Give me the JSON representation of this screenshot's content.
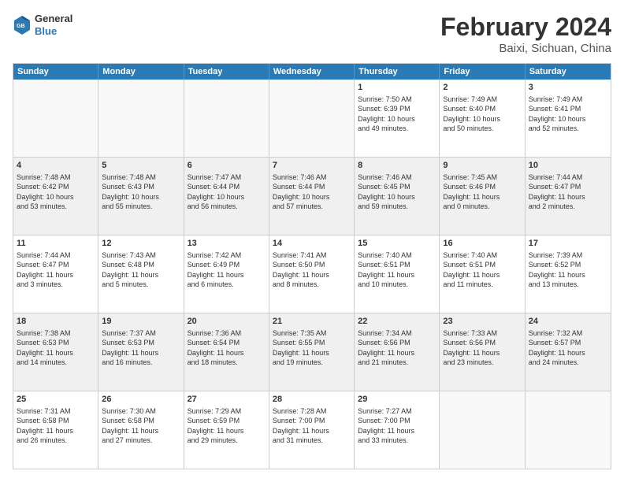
{
  "logo": {
    "general": "General",
    "blue": "Blue"
  },
  "title": "February 2024",
  "subtitle": "Baixi, Sichuan, China",
  "days": [
    "Sunday",
    "Monday",
    "Tuesday",
    "Wednesday",
    "Thursday",
    "Friday",
    "Saturday"
  ],
  "weeks": [
    [
      {
        "day": "",
        "lines": []
      },
      {
        "day": "",
        "lines": []
      },
      {
        "day": "",
        "lines": []
      },
      {
        "day": "",
        "lines": []
      },
      {
        "day": "1",
        "lines": [
          "Sunrise: 7:50 AM",
          "Sunset: 6:39 PM",
          "Daylight: 10 hours",
          "and 49 minutes."
        ]
      },
      {
        "day": "2",
        "lines": [
          "Sunrise: 7:49 AM",
          "Sunset: 6:40 PM",
          "Daylight: 10 hours",
          "and 50 minutes."
        ]
      },
      {
        "day": "3",
        "lines": [
          "Sunrise: 7:49 AM",
          "Sunset: 6:41 PM",
          "Daylight: 10 hours",
          "and 52 minutes."
        ]
      }
    ],
    [
      {
        "day": "4",
        "lines": [
          "Sunrise: 7:48 AM",
          "Sunset: 6:42 PM",
          "Daylight: 10 hours",
          "and 53 minutes."
        ]
      },
      {
        "day": "5",
        "lines": [
          "Sunrise: 7:48 AM",
          "Sunset: 6:43 PM",
          "Daylight: 10 hours",
          "and 55 minutes."
        ]
      },
      {
        "day": "6",
        "lines": [
          "Sunrise: 7:47 AM",
          "Sunset: 6:44 PM",
          "Daylight: 10 hours",
          "and 56 minutes."
        ]
      },
      {
        "day": "7",
        "lines": [
          "Sunrise: 7:46 AM",
          "Sunset: 6:44 PM",
          "Daylight: 10 hours",
          "and 57 minutes."
        ]
      },
      {
        "day": "8",
        "lines": [
          "Sunrise: 7:46 AM",
          "Sunset: 6:45 PM",
          "Daylight: 10 hours",
          "and 59 minutes."
        ]
      },
      {
        "day": "9",
        "lines": [
          "Sunrise: 7:45 AM",
          "Sunset: 6:46 PM",
          "Daylight: 11 hours",
          "and 0 minutes."
        ]
      },
      {
        "day": "10",
        "lines": [
          "Sunrise: 7:44 AM",
          "Sunset: 6:47 PM",
          "Daylight: 11 hours",
          "and 2 minutes."
        ]
      }
    ],
    [
      {
        "day": "11",
        "lines": [
          "Sunrise: 7:44 AM",
          "Sunset: 6:47 PM",
          "Daylight: 11 hours",
          "and 3 minutes."
        ]
      },
      {
        "day": "12",
        "lines": [
          "Sunrise: 7:43 AM",
          "Sunset: 6:48 PM",
          "Daylight: 11 hours",
          "and 5 minutes."
        ]
      },
      {
        "day": "13",
        "lines": [
          "Sunrise: 7:42 AM",
          "Sunset: 6:49 PM",
          "Daylight: 11 hours",
          "and 6 minutes."
        ]
      },
      {
        "day": "14",
        "lines": [
          "Sunrise: 7:41 AM",
          "Sunset: 6:50 PM",
          "Daylight: 11 hours",
          "and 8 minutes."
        ]
      },
      {
        "day": "15",
        "lines": [
          "Sunrise: 7:40 AM",
          "Sunset: 6:51 PM",
          "Daylight: 11 hours",
          "and 10 minutes."
        ]
      },
      {
        "day": "16",
        "lines": [
          "Sunrise: 7:40 AM",
          "Sunset: 6:51 PM",
          "Daylight: 11 hours",
          "and 11 minutes."
        ]
      },
      {
        "day": "17",
        "lines": [
          "Sunrise: 7:39 AM",
          "Sunset: 6:52 PM",
          "Daylight: 11 hours",
          "and 13 minutes."
        ]
      }
    ],
    [
      {
        "day": "18",
        "lines": [
          "Sunrise: 7:38 AM",
          "Sunset: 6:53 PM",
          "Daylight: 11 hours",
          "and 14 minutes."
        ]
      },
      {
        "day": "19",
        "lines": [
          "Sunrise: 7:37 AM",
          "Sunset: 6:53 PM",
          "Daylight: 11 hours",
          "and 16 minutes."
        ]
      },
      {
        "day": "20",
        "lines": [
          "Sunrise: 7:36 AM",
          "Sunset: 6:54 PM",
          "Daylight: 11 hours",
          "and 18 minutes."
        ]
      },
      {
        "day": "21",
        "lines": [
          "Sunrise: 7:35 AM",
          "Sunset: 6:55 PM",
          "Daylight: 11 hours",
          "and 19 minutes."
        ]
      },
      {
        "day": "22",
        "lines": [
          "Sunrise: 7:34 AM",
          "Sunset: 6:56 PM",
          "Daylight: 11 hours",
          "and 21 minutes."
        ]
      },
      {
        "day": "23",
        "lines": [
          "Sunrise: 7:33 AM",
          "Sunset: 6:56 PM",
          "Daylight: 11 hours",
          "and 23 minutes."
        ]
      },
      {
        "day": "24",
        "lines": [
          "Sunrise: 7:32 AM",
          "Sunset: 6:57 PM",
          "Daylight: 11 hours",
          "and 24 minutes."
        ]
      }
    ],
    [
      {
        "day": "25",
        "lines": [
          "Sunrise: 7:31 AM",
          "Sunset: 6:58 PM",
          "Daylight: 11 hours",
          "and 26 minutes."
        ]
      },
      {
        "day": "26",
        "lines": [
          "Sunrise: 7:30 AM",
          "Sunset: 6:58 PM",
          "Daylight: 11 hours",
          "and 27 minutes."
        ]
      },
      {
        "day": "27",
        "lines": [
          "Sunrise: 7:29 AM",
          "Sunset: 6:59 PM",
          "Daylight: 11 hours",
          "and 29 minutes."
        ]
      },
      {
        "day": "28",
        "lines": [
          "Sunrise: 7:28 AM",
          "Sunset: 7:00 PM",
          "Daylight: 11 hours",
          "and 31 minutes."
        ]
      },
      {
        "day": "29",
        "lines": [
          "Sunrise: 7:27 AM",
          "Sunset: 7:00 PM",
          "Daylight: 11 hours",
          "and 33 minutes."
        ]
      },
      {
        "day": "",
        "lines": []
      },
      {
        "day": "",
        "lines": []
      }
    ]
  ]
}
